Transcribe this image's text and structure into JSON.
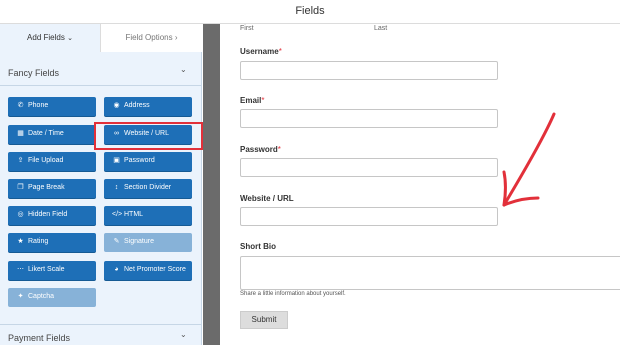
{
  "topbar": {
    "title": "Fields"
  },
  "sidebar": {
    "tabs": {
      "add_fields": "Add Fields",
      "field_options": "Field Options",
      "add_icon": "chevron-down-icon",
      "options_icon": "chevron-right-icon"
    },
    "fancy_section": {
      "label": "Fancy Fields",
      "icon": "chevron-down-icon"
    },
    "buttons": [
      {
        "label": "Phone",
        "icon": "phone-icon"
      },
      {
        "label": "Address",
        "icon": "map-marker-icon"
      },
      {
        "label": "Date / Time",
        "icon": "calendar-icon"
      },
      {
        "label": "Website / URL",
        "icon": "link-icon"
      },
      {
        "label": "File Upload",
        "icon": "upload-icon"
      },
      {
        "label": "Password",
        "icon": "lock-icon"
      },
      {
        "label": "Page Break",
        "icon": "copy-icon"
      },
      {
        "label": "Section Divider",
        "icon": "arrows-icon"
      },
      {
        "label": "Hidden Field",
        "icon": "eye-slash-icon"
      },
      {
        "label": "HTML",
        "icon": "code-icon"
      },
      {
        "label": "Rating",
        "icon": "star-icon"
      },
      {
        "label": "Signature",
        "icon": "pencil-icon"
      },
      {
        "label": "Likert Scale",
        "icon": "dots-icon"
      },
      {
        "label": "Net Promoter Score",
        "icon": "gauge-icon"
      },
      {
        "label": "Captcha",
        "icon": "puzzle-icon"
      }
    ],
    "payment_section": {
      "label": "Payment Fields",
      "icon": "chevron-down-icon"
    }
  },
  "form": {
    "name_sublabels": {
      "first": "First",
      "last": "Last"
    },
    "fields": {
      "username": {
        "label": "Username",
        "required": "*"
      },
      "email": {
        "label": "Email",
        "required": "*"
      },
      "password": {
        "label": "Password",
        "required": "*"
      },
      "website": {
        "label": "Website / URL"
      },
      "bio": {
        "label": "Short Bio",
        "help": "Share a little information about yourself."
      }
    },
    "submit_label": "Submit"
  },
  "colors": {
    "button_blue": "#1e6fb7",
    "button_disabled": "#87b2d8",
    "sidebar_bg": "#ebf3fc",
    "highlight_red": "#e2303a",
    "annotation_arrow": "#e2303a",
    "divider_gray": "#6b6b6b"
  }
}
